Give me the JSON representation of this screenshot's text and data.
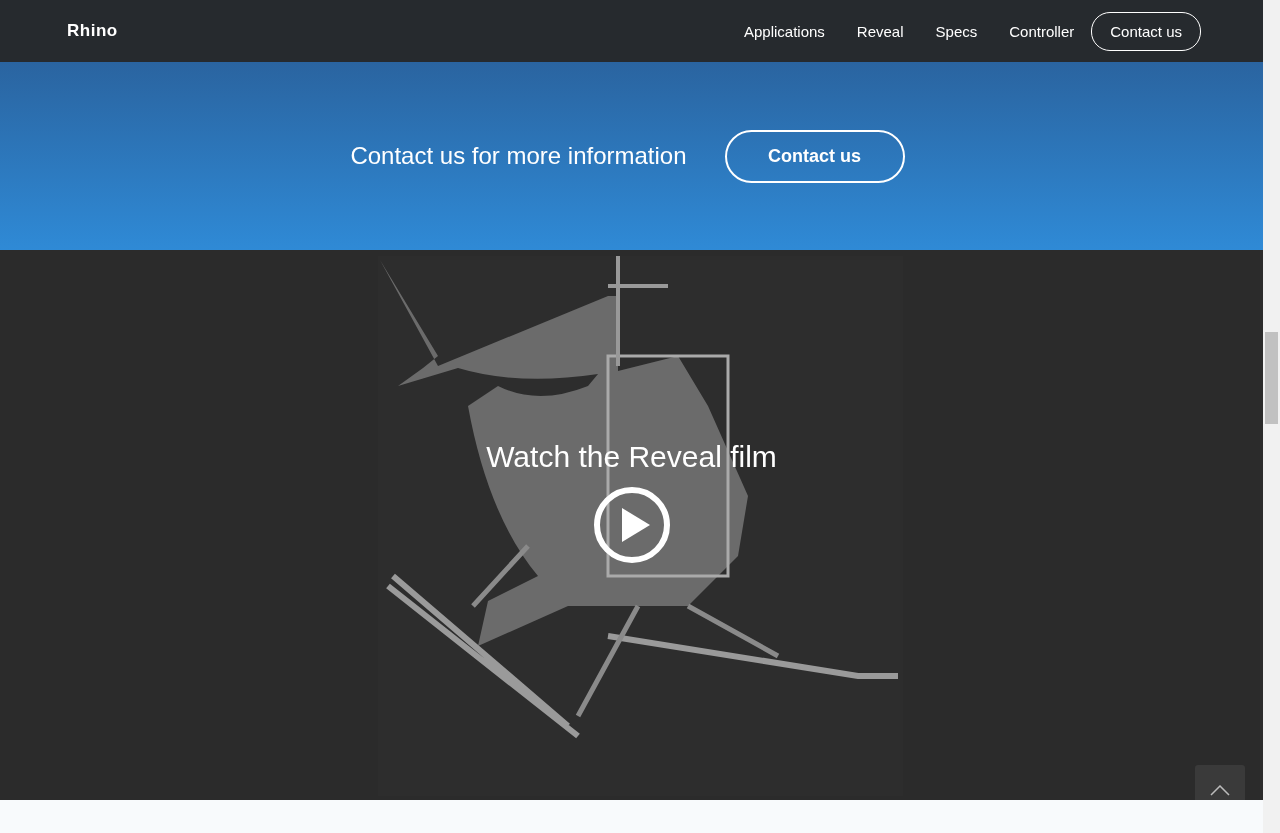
{
  "header": {
    "logo": "Rhino",
    "nav": [
      {
        "label": "Applications",
        "kind": "link"
      },
      {
        "label": "Reveal",
        "kind": "link"
      },
      {
        "label": "Specs",
        "kind": "link"
      },
      {
        "label": "Controller",
        "kind": "link"
      },
      {
        "label": "Contact us",
        "kind": "outlined"
      }
    ]
  },
  "cta": {
    "text": "Contact us for more information",
    "button": "Contact us"
  },
  "video": {
    "title": "Watch the Reveal film"
  }
}
